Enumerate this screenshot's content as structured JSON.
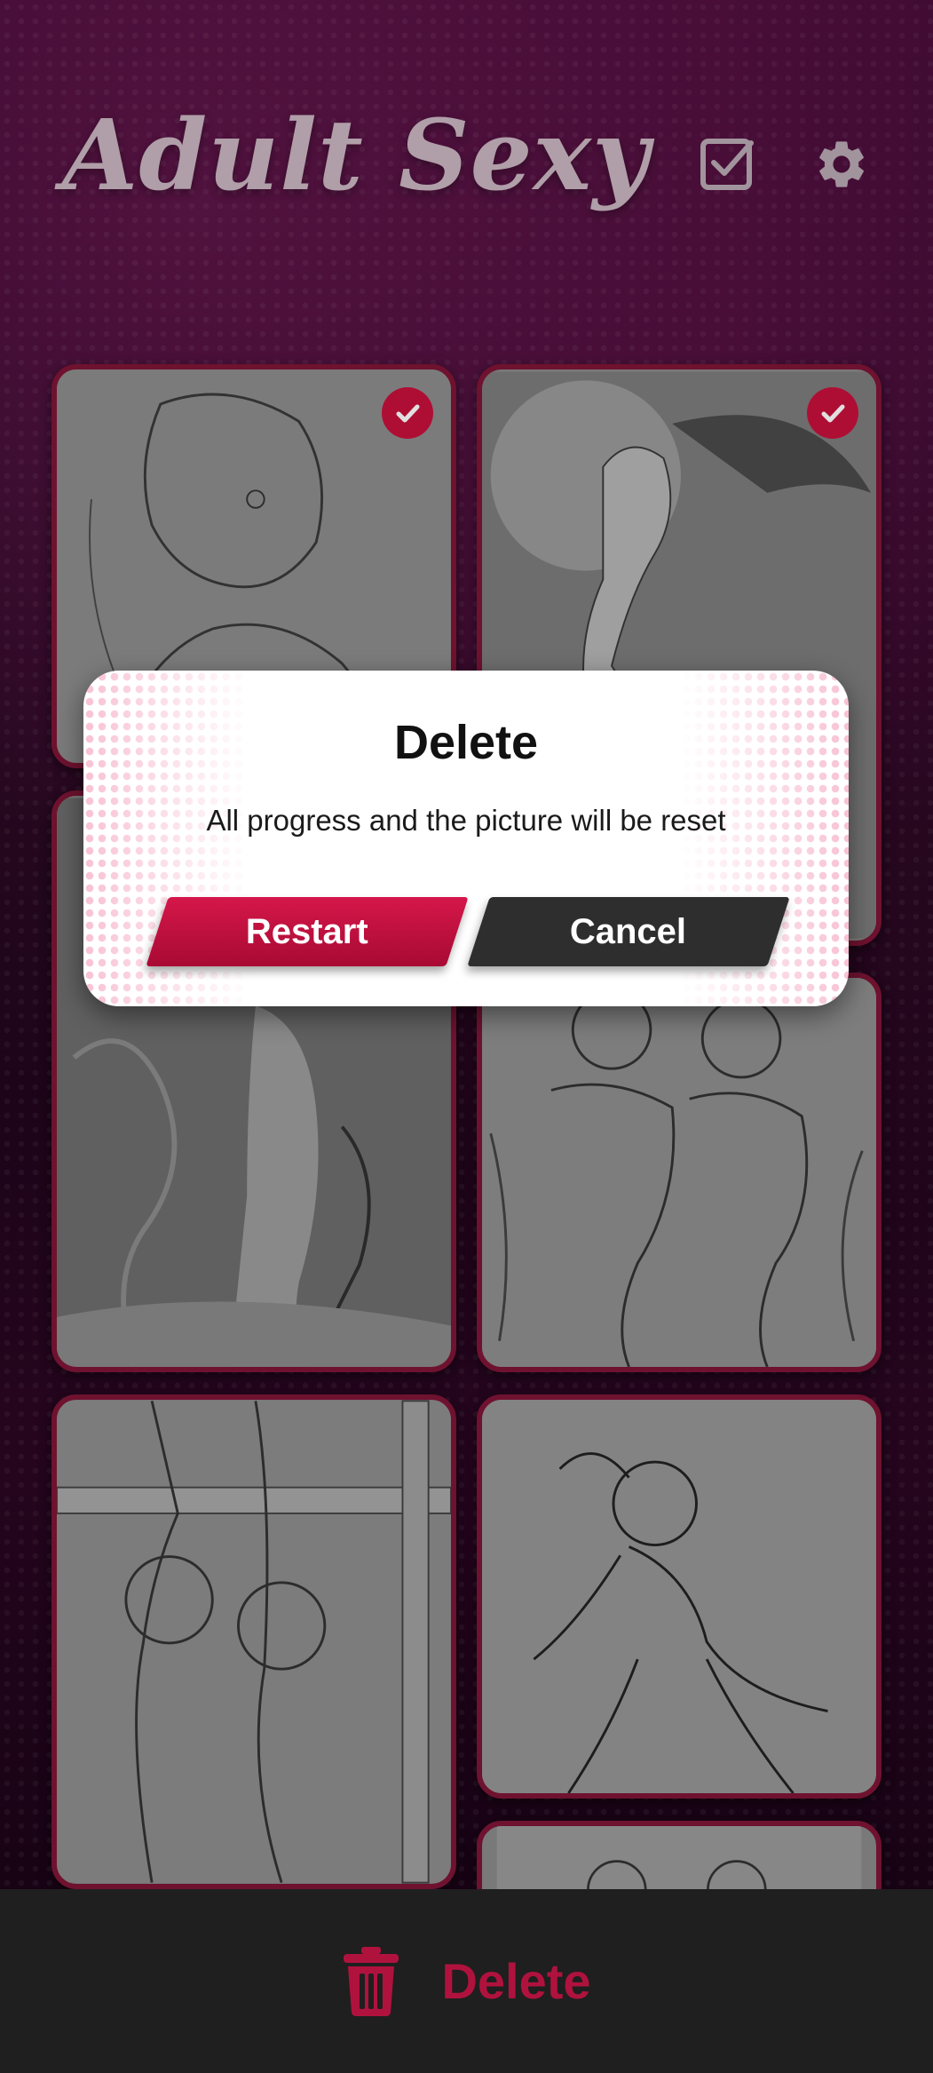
{
  "header": {
    "title": "Adult Sexy",
    "select_icon": "checkbox-check-icon",
    "settings_icon": "gear-icon"
  },
  "gallery": {
    "cards": [
      {
        "selected": true
      },
      {
        "selected": true
      },
      {
        "selected": false
      },
      {
        "selected": false
      },
      {
        "selected": false
      },
      {
        "selected": false
      },
      {
        "selected": false
      }
    ]
  },
  "dialog": {
    "title": "Delete",
    "message": "All progress and the picture will be reset",
    "restart_label": "Restart",
    "cancel_label": "Cancel"
  },
  "bottom_bar": {
    "delete_label": "Delete",
    "delete_icon": "trash-icon"
  },
  "colors": {
    "accent": "#c8103c",
    "card_border": "#7e1536",
    "dialog_bg": "#ffffff",
    "cancel_bg": "#2e2e2e",
    "bottom_bar_bg": "#1f1f1f"
  }
}
